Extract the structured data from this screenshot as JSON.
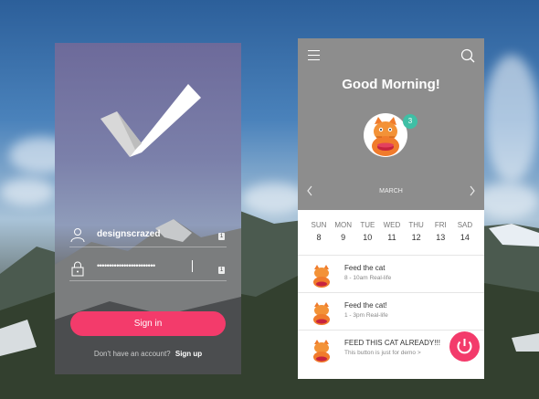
{
  "login": {
    "username": "designscrazed",
    "password_mask": "••••••••••••••••••••••••",
    "field_badge": "1",
    "signin_label": "Sign in",
    "no_account_text": "Don't have an account?",
    "signup_label": "Sign up"
  },
  "todo": {
    "greeting": "Good Morning!",
    "notification_count": "3",
    "month": "MARCH",
    "days": [
      {
        "name": "SUN",
        "date": "8"
      },
      {
        "name": "MON",
        "date": "9"
      },
      {
        "name": "TUE",
        "date": "10"
      },
      {
        "name": "WED",
        "date": "11"
      },
      {
        "name": "THU",
        "date": "12"
      },
      {
        "name": "FRI",
        "date": "13"
      },
      {
        "name": "SAD",
        "date": "14"
      }
    ],
    "tasks": [
      {
        "title": "Feed the cat",
        "subtitle": "8 - 10am Real-life"
      },
      {
        "title": "Feed the cat!",
        "subtitle": "1 - 3pm Real-life"
      },
      {
        "title": "FEED THIS CAT ALREADY!!!",
        "subtitle": "This button is just for demo >"
      }
    ]
  },
  "colors": {
    "accent_pink": "#f33b6b",
    "badge_teal": "#3fbfa5",
    "header_gray": "#8d8d8d"
  },
  "icons": [
    "user-icon",
    "lock-icon",
    "checkmark-logo-icon",
    "menu-icon",
    "search-icon",
    "chevron-left-icon",
    "chevron-right-icon",
    "cat-avatar-icon",
    "power-icon"
  ]
}
